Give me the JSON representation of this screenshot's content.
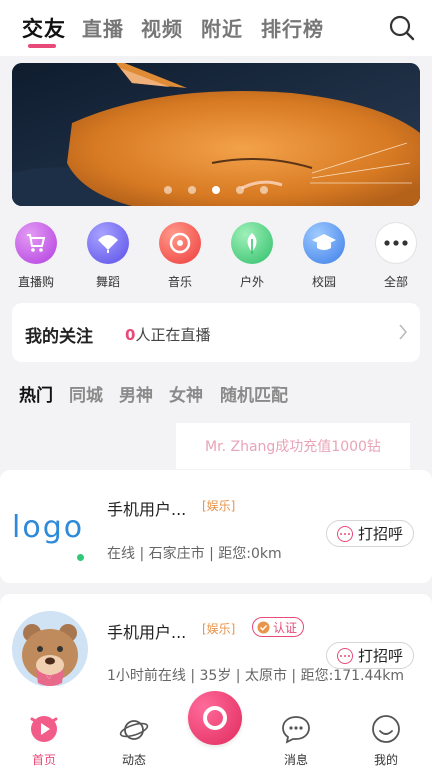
{
  "top_tabs": [
    "交友",
    "直播",
    "视频",
    "附近",
    "排行榜"
  ],
  "categories": [
    "直播购",
    "舞蹈",
    "音乐",
    "户外",
    "校园",
    "全部"
  ],
  "follow": {
    "title": "我的关注",
    "live_count": "0",
    "live_suffix": "人正在直播"
  },
  "sub_tabs": [
    "热门",
    "同城",
    "男神",
    "女神",
    "随机匹配"
  ],
  "ticker": "Mr. Zhang成功充值1000钻",
  "users": [
    {
      "avatar_text": "logo",
      "name": "手机用户...",
      "tag": "[娱乐]",
      "meta": "在线 | 石家庄市 | 距您:0km",
      "greet": "打招呼"
    },
    {
      "name": "手机用户...",
      "tag": "[娱乐]",
      "badge": "认证",
      "meta": "1小时前在线 | 35岁 | 太原市 | 距您:171.44km",
      "greet": "打招呼"
    }
  ],
  "bottom_nav": [
    "首页",
    "动态",
    "消息",
    "我的"
  ],
  "colors": {
    "accent": "#e84a7a",
    "online": "#32c879",
    "tag": "#e8944a"
  },
  "banner": {
    "pages": 5,
    "active_page": 3
  }
}
